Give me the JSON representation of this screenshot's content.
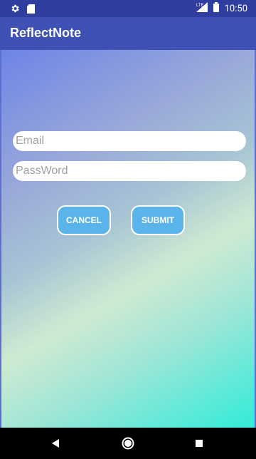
{
  "status_bar": {
    "time": "10:50",
    "network": "LTE",
    "icons": [
      "gear-icon",
      "sd-card-icon",
      "signal-icon",
      "battery-icon"
    ]
  },
  "app_bar": {
    "title": "ReflectNote",
    "color": "#3F51B5"
  },
  "form": {
    "email_placeholder": "Email",
    "password_placeholder": "PassWord",
    "cancel_label": "CANCEL",
    "submit_label": "SUBMIT",
    "button_color": "#5AB4E9"
  },
  "nav_bar": {
    "items": [
      "back-icon",
      "home-icon",
      "recents-icon"
    ]
  }
}
